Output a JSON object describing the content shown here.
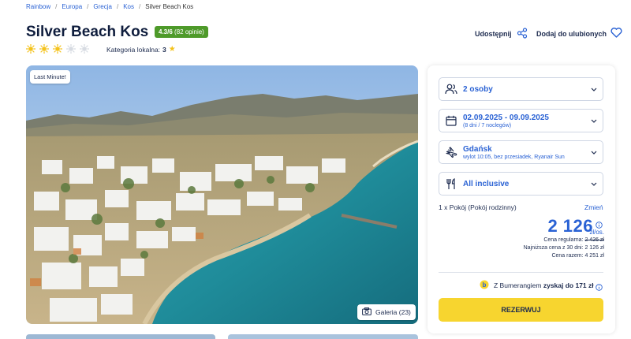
{
  "breadcrumb": {
    "items": [
      "Rainbow",
      "Europa",
      "Grecja",
      "Kos"
    ],
    "current": "Silver Beach Kos"
  },
  "hotel": {
    "name": "Silver Beach Kos",
    "rating": "4.3/6",
    "reviews": "(82 opinie)",
    "suns_total": 5,
    "suns_filled": 3,
    "local_category_label": "Kategoria lokalna:",
    "local_category_value": "3"
  },
  "actions": {
    "share_label": "Udostępnij",
    "favorite_label": "Dodaj do ulubionych"
  },
  "gallery": {
    "badge": "Last Minute!",
    "button_label": "Galeria (23)"
  },
  "booking": {
    "persons": "2 osoby",
    "dates": "02.09.2025 - 09.09.2025",
    "dates_sub": "(8 dni / 7 noclegów)",
    "departure": "Gdańsk",
    "departure_sub": "wylot 10:05, bez przesiadek, Ryanair Sun",
    "board": "All inclusive",
    "room_label": "1 x Pokój",
    "room_type": "(Pokój rodzinny)",
    "change_label": "Zmień",
    "price": "2 126",
    "price_unit": "zł/os.",
    "regular_label": "Cena regularna:",
    "regular_value": "2 426 zł",
    "lowest_label": "Najniższa cena z 30 dni:",
    "lowest_value": "2 126 zł",
    "total_label": "Cena razem:",
    "total_value": "4 251 zł",
    "bumerang_pre": "Z Bumerangiem",
    "bumerang_bold": "zyskaj do 171 zł",
    "reserve_label": "REZERWUJ"
  },
  "colors": {
    "accent": "#2a62d4",
    "rating_green": "#4e9a2a",
    "reserve_yellow": "#f7d52f",
    "sun": "#f4c21b"
  }
}
